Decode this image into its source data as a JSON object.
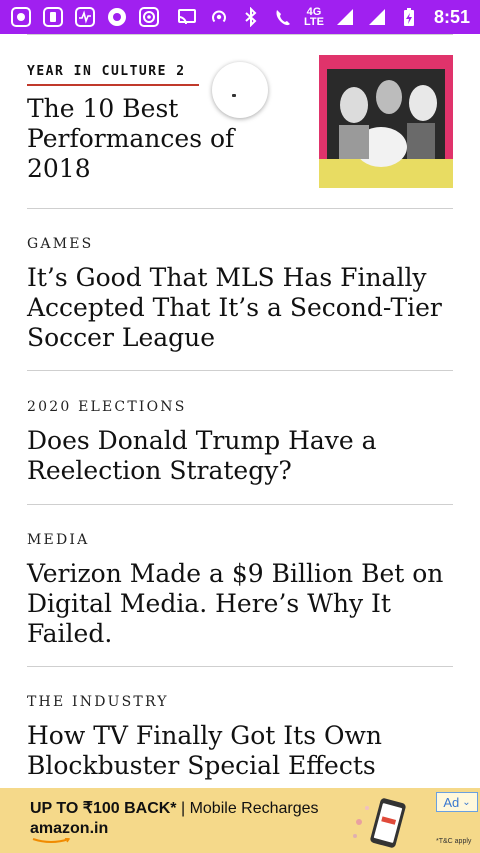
{
  "status_bar": {
    "time": "8:51",
    "network_top": "4G",
    "network_bottom": "LTE",
    "icons_left": [
      "notification-app-icon",
      "phone-sync-icon",
      "activity-icon",
      "circle-app-icon",
      "target-app-icon"
    ],
    "icons_right": [
      "cast-icon",
      "hotspot-icon",
      "bluetooth-icon",
      "wifi-calling-icon",
      "signal-icon",
      "signal-icon-2",
      "battery-charging-icon"
    ]
  },
  "stories": [
    {
      "kicker": "YEAR IN CULTURE 2",
      "headline": "The 10 Best Performances of 2018"
    },
    {
      "kicker": "GAMES",
      "headline": "It’s Good That MLS Has Finally Accepted That It’s a Second-Tier Soccer League"
    },
    {
      "kicker": "2020 ELECTIONS",
      "headline": "Does Donald Trump Have a Reelection Strategy?"
    },
    {
      "kicker": "MEDIA",
      "headline": "Verizon Made a $9 Billion Bet on Digital Media. Here’s Why It Failed."
    },
    {
      "kicker": "THE INDUSTRY",
      "headline": "How TV Finally Got Its Own Blockbuster Special Effects"
    }
  ],
  "ad": {
    "line1_bold": "UP TO ₹100 BACK*",
    "line1_rest": " | Mobile Recharges",
    "brand": "amazon.in",
    "badge": "Ad",
    "terms": "*T&C apply",
    "colors": {
      "background": "#f5d98a",
      "badge": "#3a78d0"
    }
  },
  "colors": {
    "status_bar": "#a020f0",
    "kicker_underline": "#c0392b",
    "divider": "#cfcfcf"
  }
}
